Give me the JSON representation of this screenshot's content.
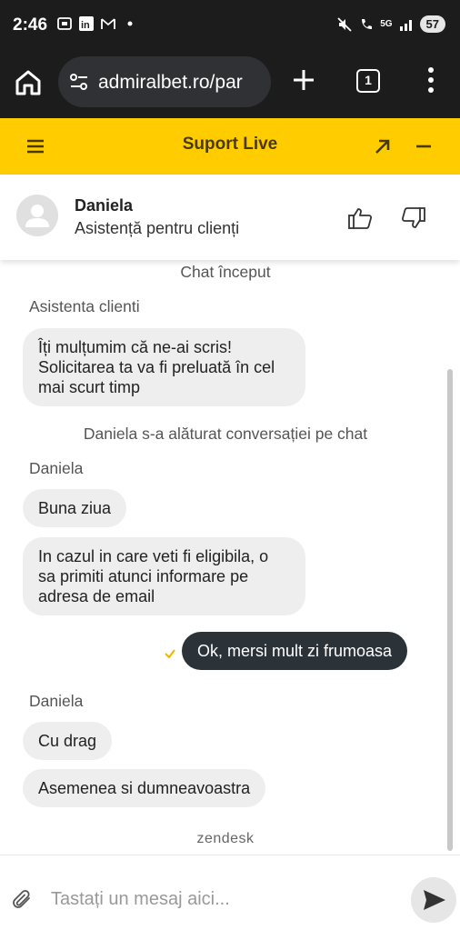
{
  "status_bar": {
    "time": "2:46",
    "network": "5G",
    "battery": "57"
  },
  "browser": {
    "url": "admiralbet.ro/par",
    "tab_count": "1"
  },
  "chat_header": {
    "title": "Suport Live"
  },
  "agent": {
    "name": "Daniela",
    "role": "Asistență pentru clienți"
  },
  "messages": {
    "chat_started": "Chat început",
    "sender_1": "Asistenta clienti",
    "bubble_1": "Îți mulțumim că ne-ai scris! Solicitarea ta va fi preluată în cel mai scurt timp",
    "joined": "Daniela s-a alăturat conversației pe chat",
    "sender_2": "Daniela",
    "bubble_2": "Buna ziua",
    "bubble_3": "In cazul in care veti fi eligibila, o sa primiti atunci informare pe adresa de email",
    "outgoing_1": "Ok, mersi mult zi frumoasa",
    "sender_3": "Daniela",
    "bubble_4": "Cu drag",
    "bubble_5": "Asemenea si dumneavoastra"
  },
  "branding": {
    "footer": "zendesk"
  },
  "input": {
    "placeholder": "Tastați un mesaj aici..."
  },
  "colors": {
    "header_yellow": "#ffcc00",
    "dark_bar": "#1c1c1c",
    "outgoing_bubble": "#2b3338",
    "incoming_bubble": "#eeeeee",
    "check_yellow": "#f0b400"
  }
}
